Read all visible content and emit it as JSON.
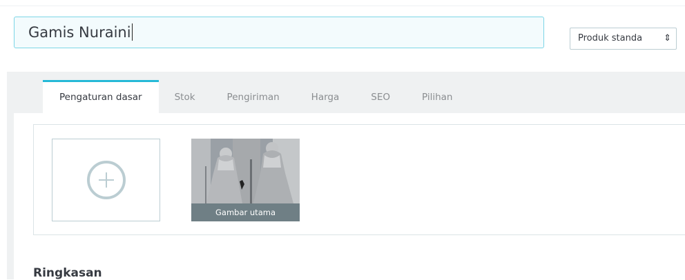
{
  "product": {
    "name": "Gamis Nuraini",
    "type_selected": "Produk standa"
  },
  "tabs": [
    {
      "label": "Pengaturan dasar",
      "active": true
    },
    {
      "label": "Stok"
    },
    {
      "label": "Pengiriman"
    },
    {
      "label": "Harga"
    },
    {
      "label": "SEO"
    },
    {
      "label": "Pilihan"
    }
  ],
  "images": {
    "add_icon": "plus-circle-icon",
    "cover_caption": "Gambar utama"
  },
  "summary": {
    "title": "Ringkasan"
  },
  "colors": {
    "accent": "#25b9d7",
    "input_border": "#7cd5e6",
    "panel_bg": "#eff1f2",
    "caption_bg": "#6f7f85"
  }
}
